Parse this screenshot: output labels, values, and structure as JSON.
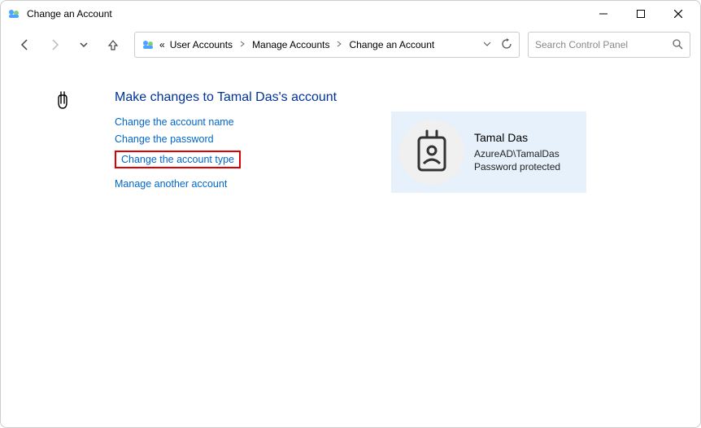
{
  "window": {
    "title": "Change an Account"
  },
  "breadcrumb": {
    "prefix": "«",
    "items": [
      "User Accounts",
      "Manage Accounts",
      "Change an Account"
    ]
  },
  "search": {
    "placeholder": "Search Control Panel"
  },
  "page": {
    "heading": "Make changes to Tamal Das's account"
  },
  "links": {
    "change_name": "Change the account name",
    "change_password": "Change the password",
    "change_type": "Change the account type",
    "manage_another": "Manage another account"
  },
  "account": {
    "name": "Tamal Das",
    "domain": "AzureAD\\TamalDas",
    "status": "Password protected"
  }
}
